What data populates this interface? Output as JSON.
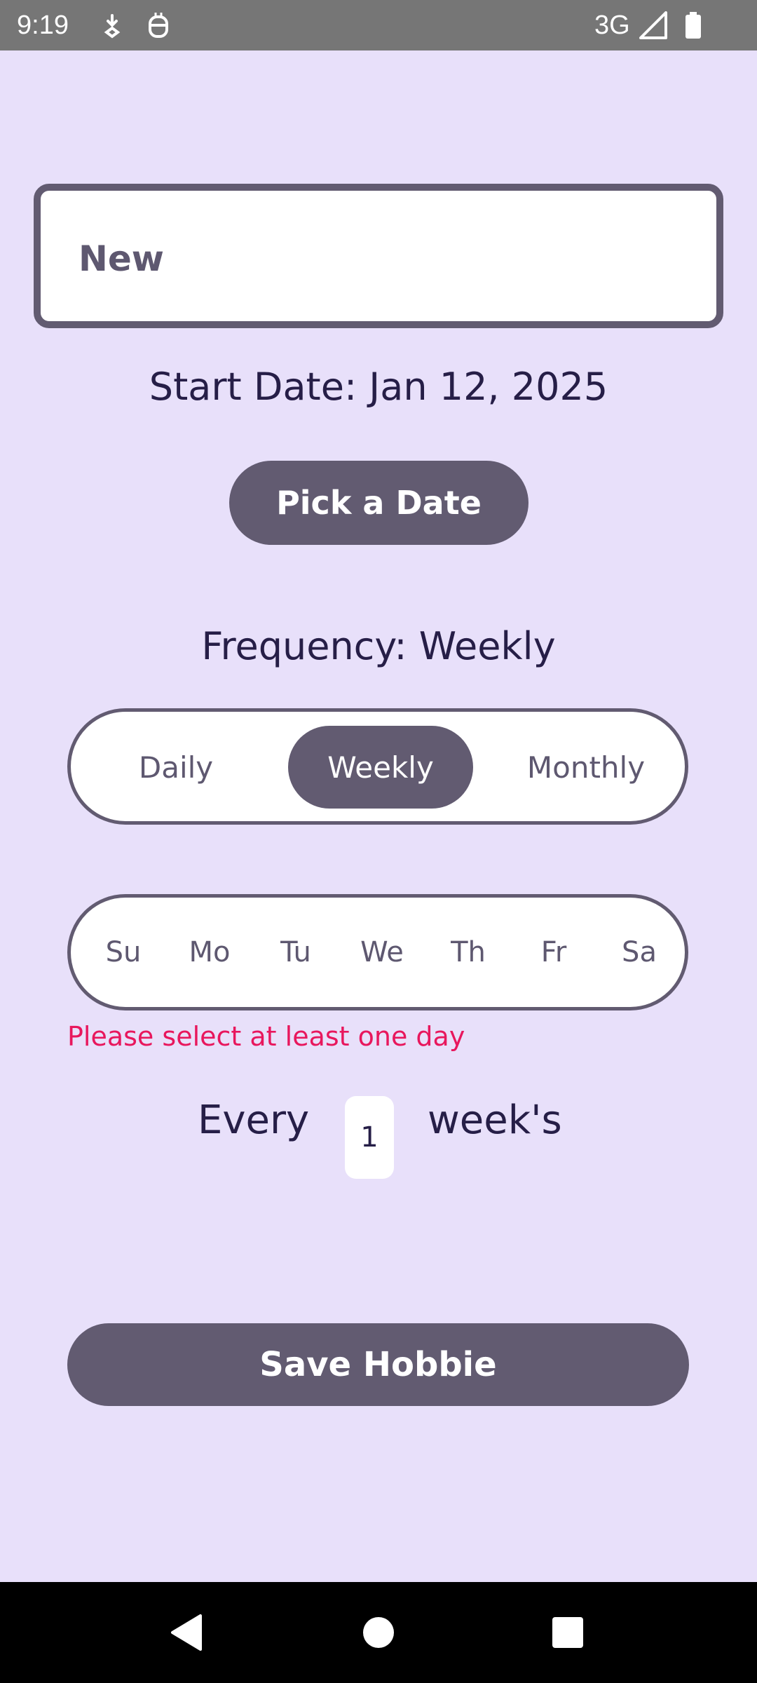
{
  "status_bar": {
    "time": "9:19",
    "network": "3G",
    "left_icons": [
      "location-download-icon",
      "android-debug-icon"
    ],
    "right_icons": [
      "signal-icon",
      "battery-icon"
    ]
  },
  "form": {
    "name_value": "New",
    "start_date_text": "Start Date: Jan 12, 2025",
    "pick_date_label": "Pick a Date",
    "frequency_text": "Frequency: Weekly",
    "frequency_options": [
      "Daily",
      "Weekly",
      "Monthly"
    ],
    "frequency_selected": "Weekly",
    "days": [
      "Su",
      "Mo",
      "Tu",
      "We",
      "Th",
      "Fr",
      "Sa"
    ],
    "error_text": "Please select at least one day",
    "every_label": "Every",
    "interval_value": "1",
    "unit_label": "week's",
    "save_label": "Save Hobbie"
  },
  "nav_bar": {
    "buttons": [
      "back-icon",
      "home-icon",
      "recents-icon"
    ]
  },
  "colors": {
    "background": "#E8E0FA",
    "primary": "#625B71",
    "text_dark": "#261E47",
    "error": "#E8175D",
    "status_bar": "#767676"
  }
}
